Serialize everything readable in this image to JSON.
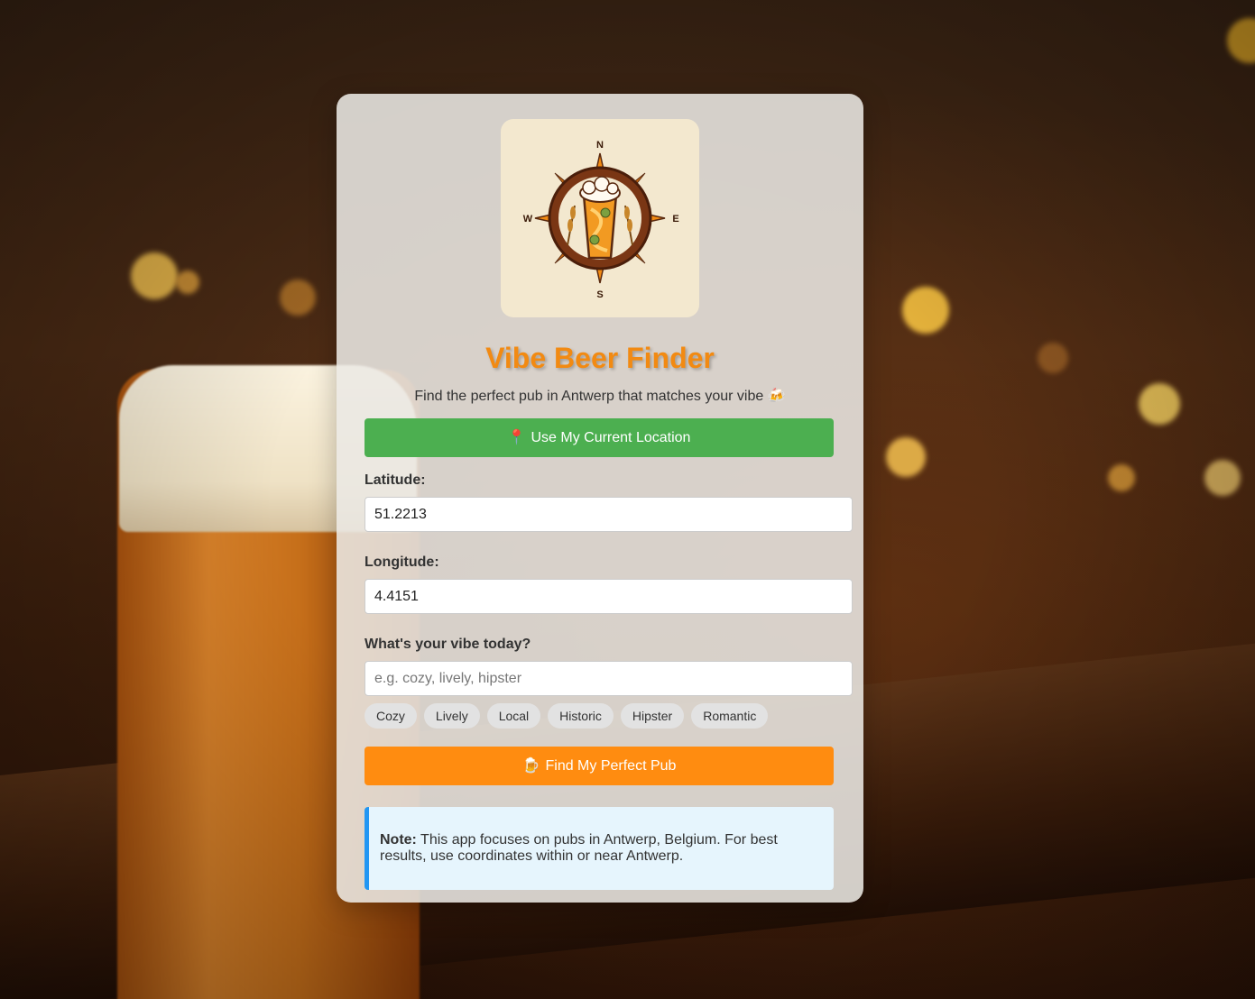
{
  "app": {
    "title": "Vibe Beer Finder",
    "subtitle": "Find the perfect pub in Antwerp that matches your vibe 🍻"
  },
  "logo": {
    "compass_labels": {
      "north": "N",
      "south": "S",
      "east": "E",
      "west": "W"
    },
    "icon": "beer-compass-logo"
  },
  "location_button": {
    "icon": "📍",
    "label": "Use My Current Location"
  },
  "latitude": {
    "label": "Latitude:",
    "value": "51.2213"
  },
  "longitude": {
    "label": "Longitude:",
    "value": "4.4151"
  },
  "vibe": {
    "label": "What's your vibe today?",
    "placeholder": "e.g. cozy, lively, hipster",
    "value": "",
    "chips": [
      "Cozy",
      "Lively",
      "Local",
      "Historic",
      "Hipster",
      "Romantic"
    ]
  },
  "find_button": {
    "icon": "🍺",
    "label": "Find My Perfect Pub"
  },
  "note": {
    "title": "Note:",
    "text": "This app focuses on pubs in Antwerp, Belgium. For best results, use coordinates within or near Antwerp."
  },
  "colors": {
    "title": "#f28a12",
    "location_button": "#4caf50",
    "find_button": "#ff8c10",
    "note_border": "#2196f3",
    "note_bg": "#e6f5fd"
  }
}
